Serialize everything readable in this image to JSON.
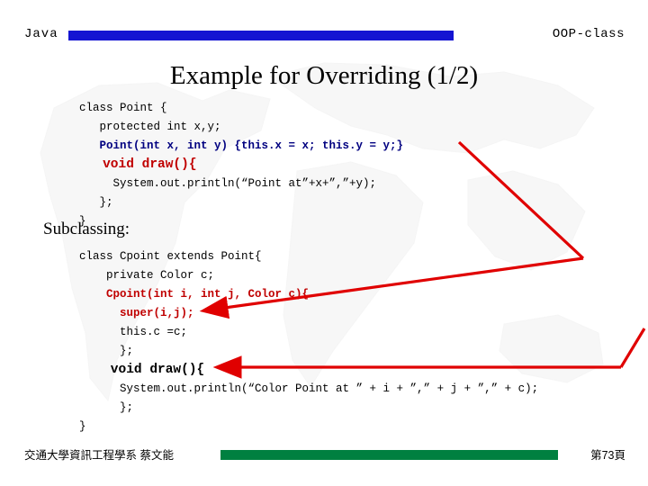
{
  "header": {
    "left_label": "Java",
    "right_label": "OOP-class",
    "bar_color": "#1414d2"
  },
  "title": "Example for Overriding (1/2)",
  "code_block_1": {
    "lines": [
      "class Point {",
      "   protected int x,y;",
      "   Point(int x, int y) {this.x = x; this.y = y;}",
      "   void draw(){",
      "     System.out.println(“Point at”+x+”,”+y);",
      "   };",
      "}"
    ]
  },
  "subheading": "Subclassing:",
  "code_block_2": {
    "lines": [
      "class Cpoint extends Point{",
      "    private Color c;",
      "    Cpoint(int i, int j, Color c){",
      "      super(i,j);",
      "      this.c =c;",
      "      };",
      "    void draw(){",
      "      System.out.println(“Color Point at ” + i + ”,” + j + ”,” + c);",
      "      };",
      "}"
    ]
  },
  "footer": {
    "left_label": "交通大學資訊工程學系  蔡文能",
    "page_label": "第73頁",
    "bar_color": "#008040"
  },
  "annotations": {
    "arrow_color": "#e00000",
    "arrow_1_desc": "arrow from Point draw method toward Cpoint constructor",
    "arrow_2_desc": "arrow from right edge toward Cpoint draw method"
  }
}
